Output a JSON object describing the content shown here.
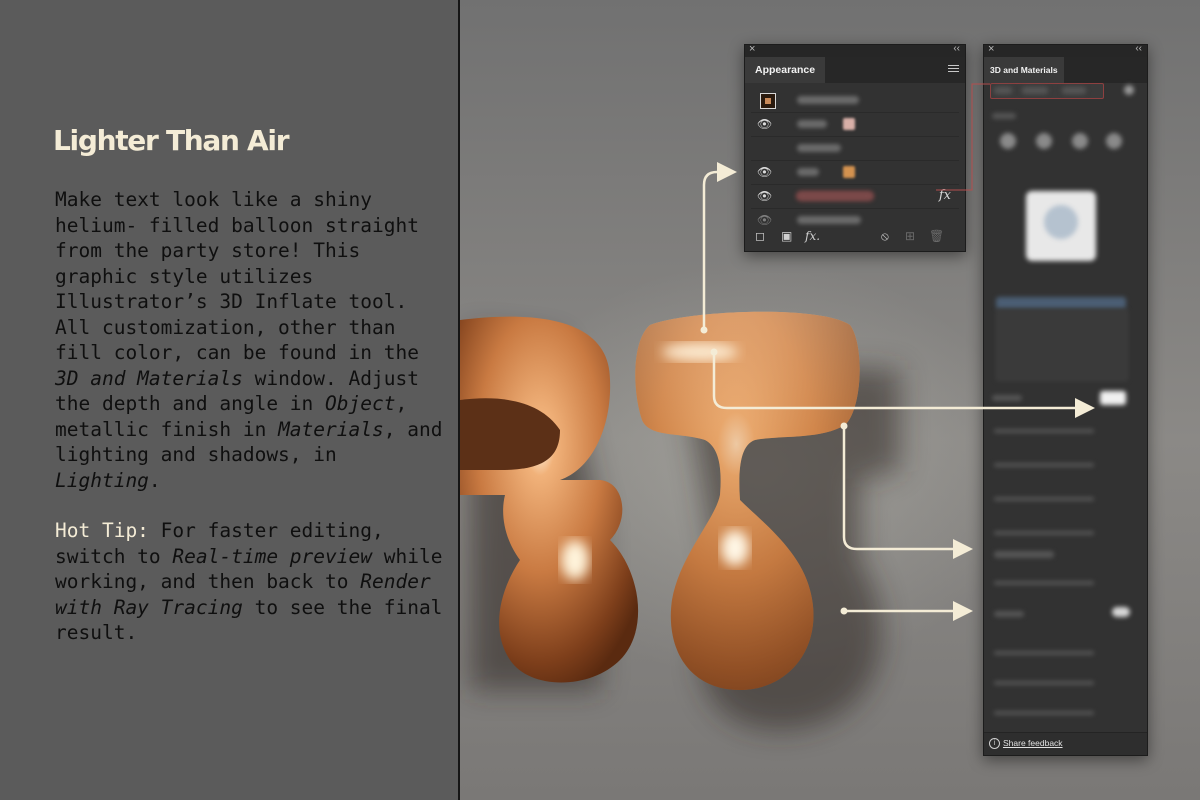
{
  "article": {
    "title": "Lighter Than Air",
    "body_parts": [
      {
        "text": "Make text look like a shiny helium- filled balloon straight from the party store! This graphic style utilizes Illustrator’s 3D Inflate tool. All customization, other than fill color, can be found in the ",
        "italic": false
      },
      {
        "text": "3D and Materials",
        "italic": true
      },
      {
        "text": " window. Adjust the depth and angle in ",
        "italic": false
      },
      {
        "text": "Object",
        "italic": true
      },
      {
        "text": ", metallic finish in ",
        "italic": false
      },
      {
        "text": "Materials",
        "italic": true
      },
      {
        "text": ", and lighting and shadows, in ",
        "italic": false
      },
      {
        "text": "Lighting",
        "italic": true
      },
      {
        "text": ".",
        "italic": false
      }
    ],
    "tip_label": "Hot Tip:",
    "tip_parts": [
      {
        "text": " For faster editing, switch to ",
        "italic": false
      },
      {
        "text": "Real-time preview",
        "italic": true
      },
      {
        "text": " while working, and then back to ",
        "italic": false
      },
      {
        "text": "Render with Ray Tracing",
        "italic": true
      },
      {
        "text": " to see the final result.",
        "italic": false
      }
    ]
  },
  "appearance_panel": {
    "tab_label": "Appearance",
    "close_glyph": "×",
    "collapse_glyph": "‹‹",
    "fx_label": "fx",
    "footer_fx_label": "fx.",
    "footer_icons": [
      "square-icon",
      "filled-square-icon",
      "fx-icon",
      "clear-icon",
      "add-icon",
      "trash-icon"
    ]
  },
  "materials_panel": {
    "tab_label": "3D and Materials",
    "close_glyph": "×",
    "collapse_glyph": "‹‹",
    "feedback_label": "Share feedback",
    "info_glyph": "i"
  },
  "colors": {
    "background": "#5b5b5b",
    "title": "#f4ecd6",
    "body": "#0f0f0f",
    "callout": "#f4ecd6",
    "highlight": "#a34b4b",
    "balloon": "#c98a5a"
  }
}
